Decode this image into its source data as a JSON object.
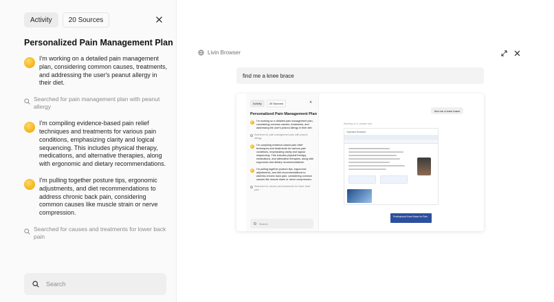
{
  "left_panel": {
    "tabs": [
      {
        "label": "Activity",
        "active": true
      },
      {
        "label": "20 Sources",
        "active": false
      }
    ],
    "title": "Personalized Pain Management Plan",
    "feed": [
      {
        "type": "thought",
        "text": "I'm working on a detailed pain management plan, considering common causes, treatments, and addressing the user's peanut allergy in their diet."
      },
      {
        "type": "search",
        "text": "Searched for pain management plan with peanut allergy"
      },
      {
        "type": "thought",
        "text": "I'm compiling evidence-based pain relief techniques and treatments for various pain conditions, emphasizing clarity and logical sequencing. This includes physical therapy, medications, and alternative therapies, along with ergonomic and dietary recommendations."
      },
      {
        "type": "thought",
        "text": "I'm pulling together posture tips, ergonomic adjustments, and diet recommendations to address chronic back pain, considering common causes like muscle strain or nerve compression."
      },
      {
        "type": "search",
        "text": "Searched for causes and treatments for lower back pain"
      }
    ],
    "search_placeholder": "Search"
  },
  "browser": {
    "title": "Livin Browser",
    "query": "find me a knee brace",
    "screenshot": {
      "tabs": [
        "Activity",
        "20 Sources"
      ],
      "title": "Personalized Pain Management Plan",
      "feed": [
        {
          "type": "thought",
          "text": "I'm working on a detailed pain management plan, considering common causes, treatments, and addressing the user's peanut allergy in their diet."
        },
        {
          "type": "search",
          "text": "Searched for pain management plan with peanut allergy"
        },
        {
          "type": "thought",
          "text": "I'm compiling evidence-based pain relief techniques and treatments for various pain conditions, emphasizing clarity and logical sequencing. This includes physical therapy, medications, and alternative therapies, along with ergonomic and dietary recommendations."
        },
        {
          "type": "thought",
          "text": "I'm pulling together posture tips, ergonomic adjustments, and diet recommendations to address chronic back pain, considering common causes like muscle strain or nerve compression."
        },
        {
          "type": "search",
          "text": "Searched for causes and treatments for lower back pain"
        }
      ],
      "search_placeholder": "Search",
      "query_pill": "find me a knee brace",
      "status": "Working on it, please wait",
      "inner_browser_title": "Operator Browser",
      "banner": "Professional Knee Brace for Pain"
    }
  },
  "colors": {
    "accent_dot": "#f5b81f",
    "muted_text": "#8a8a8a",
    "panel_bg": "#fafafa"
  },
  "icons": [
    "close-icon",
    "search-icon",
    "globe-icon",
    "expand-icon"
  ]
}
